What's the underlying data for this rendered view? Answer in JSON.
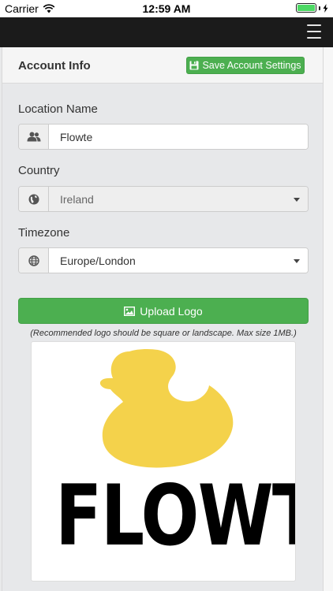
{
  "status_bar": {
    "carrier": "Carrier",
    "time": "12:59 AM"
  },
  "header": {
    "menu_icon": "hamburger-menu-icon"
  },
  "account": {
    "title": "Account Info",
    "save_button": "Save Account Settings",
    "save_icon": "save-floppy-icon"
  },
  "location": {
    "label": "Location Name",
    "value": "Flowte",
    "icon": "users-icon"
  },
  "country": {
    "label": "Country",
    "value": "Ireland",
    "icon": "globe-icon"
  },
  "timezone": {
    "label": "Timezone",
    "value": "Europe/London",
    "icon": "globe-wire-icon"
  },
  "upload": {
    "button": "Upload Logo",
    "icon": "picture-icon",
    "hint": "(Recommended logo should be square or landscape. Max size 1MB.)"
  },
  "logo": {
    "text": "FLOWTE",
    "duck_color": "#f4d24b"
  },
  "colors": {
    "accent_green": "#4caf50",
    "header_dark": "#1b1b1b"
  }
}
